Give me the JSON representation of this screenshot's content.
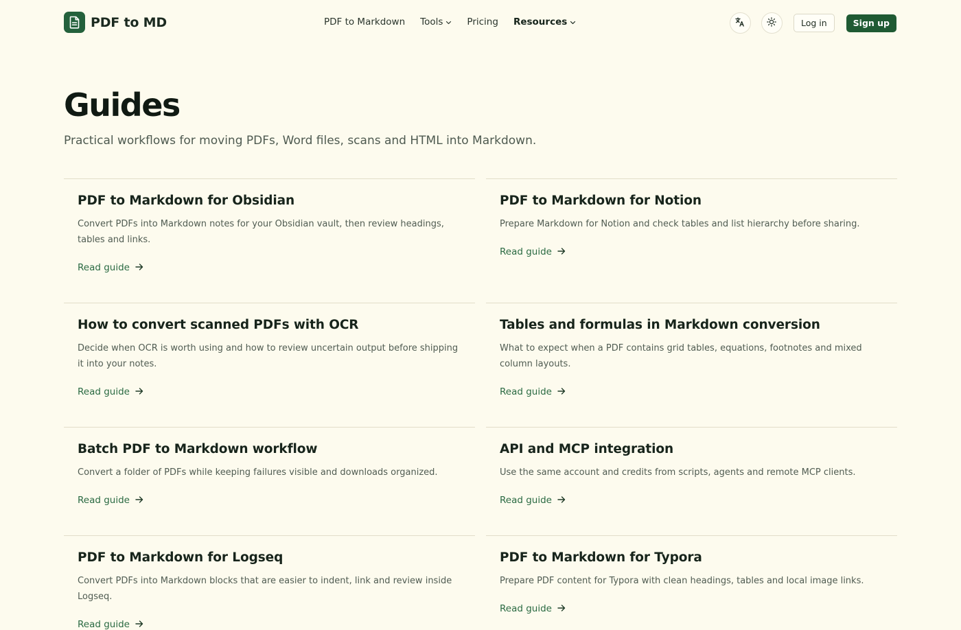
{
  "brand": {
    "name": "PDF to MD",
    "logo_icon": "document-icon",
    "accent": "#24613c"
  },
  "nav": [
    {
      "label": "PDF to Markdown",
      "has_dropdown": false,
      "active": false
    },
    {
      "label": "Tools",
      "has_dropdown": true,
      "active": false
    },
    {
      "label": "Pricing",
      "has_dropdown": false,
      "active": false
    },
    {
      "label": "Resources",
      "has_dropdown": true,
      "active": true
    }
  ],
  "actions": {
    "language_icon": "translate-icon",
    "theme_icon": "sun-icon",
    "login_label": "Log in",
    "signup_label": "Sign up"
  },
  "page": {
    "title": "Guides",
    "subtitle": "Practical workflows for moving PDFs, Word files, scans and HTML into Markdown."
  },
  "guides": [
    {
      "title": "PDF to Markdown for Obsidian",
      "description": "Convert PDFs into Markdown notes for your Obsidian vault, then review headings, tables and links.",
      "link": "Read guide"
    },
    {
      "title": "PDF to Markdown for Notion",
      "description": "Prepare Markdown for Notion and check tables and list hierarchy before sharing.",
      "link": "Read guide"
    },
    {
      "title": "How to convert scanned PDFs with OCR",
      "description": "Decide when OCR is worth using and how to review uncertain output before shipping it into your notes.",
      "link": "Read guide"
    },
    {
      "title": "Tables and formulas in Markdown conversion",
      "description": "What to expect when a PDF contains grid tables, equations, footnotes and mixed column layouts.",
      "link": "Read guide"
    },
    {
      "title": "Batch PDF to Markdown workflow",
      "description": "Convert a folder of PDFs while keeping failures visible and downloads organized.",
      "link": "Read guide"
    },
    {
      "title": "API and MCP integration",
      "description": "Use the same account and credits from scripts, agents and remote MCP clients.",
      "link": "Read guide"
    },
    {
      "title": "PDF to Markdown for Logseq",
      "description": "Convert PDFs into Markdown blocks that are easier to indent, link and review inside Logseq.",
      "link": "Read guide"
    },
    {
      "title": "PDF to Markdown for Typora",
      "description": "Prepare PDF content for Typora with clean headings, tables and local image links.",
      "link": "Read guide"
    }
  ]
}
